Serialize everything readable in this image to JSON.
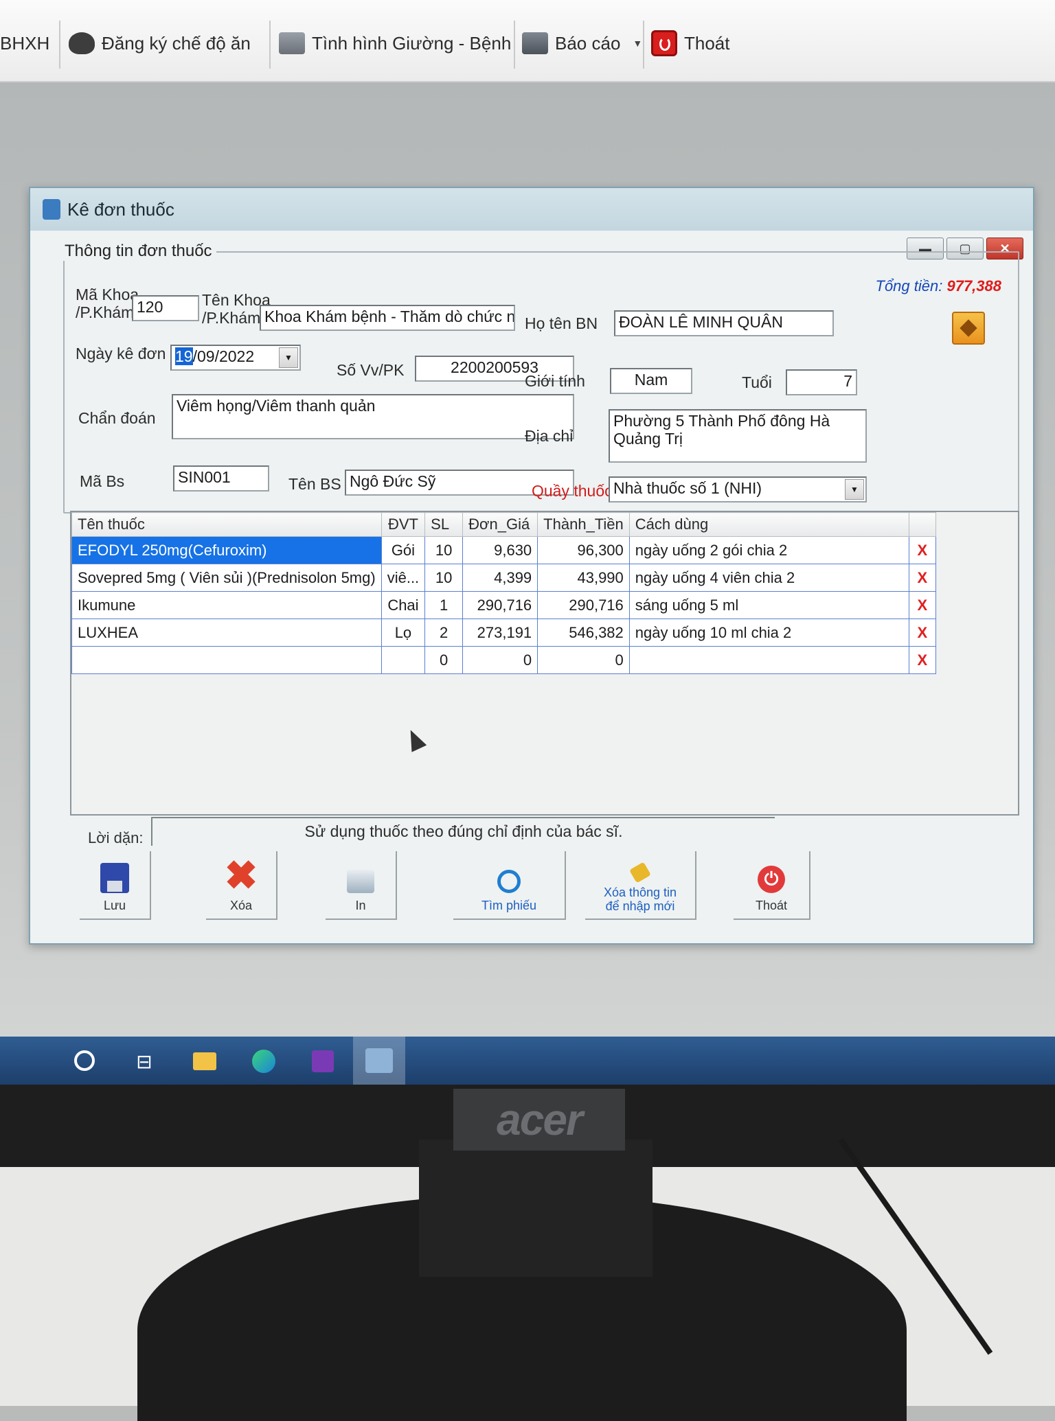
{
  "toolbar": {
    "items": [
      {
        "label": "BHXH"
      },
      {
        "label": "Đăng ký chế độ ăn",
        "icon": "chef-hat-icon"
      },
      {
        "label": "Tình hình Giường - Bệnh",
        "icon": "bed-icon"
      },
      {
        "label": "Báo cáo",
        "icon": "report-icon"
      },
      {
        "label": "Thoát",
        "icon": "exit-icon"
      }
    ]
  },
  "dialog": {
    "title": "Kê đơn thuốc",
    "group_title": "Thông tin đơn thuốc",
    "total_label": "Tổng tiền:",
    "total_value": "977,388",
    "labels": {
      "ma_khoa": "Mã Khoa /P.Khám",
      "ten_khoa": "Tên Khoa /P.Khám",
      "ho_ten": "Họ tên BN",
      "ngay_ke_don": "Ngày kê đơn",
      "so_vv": "Số Vv/PK",
      "gioi_tinh": "Giới tính",
      "tuoi": "Tuổi",
      "chan_doan": "Chẩn đoán",
      "dia_chi": "Địa chỉ",
      "ma_bs": "Mã Bs",
      "ten_bs": "Tên BS",
      "quay_thuoc": "Quầy thuốc"
    },
    "values": {
      "ma_khoa": "120",
      "ten_khoa": "Khoa Khám bệnh - Thăm dò chức n",
      "ho_ten": "ĐOÀN LÊ MINH QUÂN",
      "ngay_ke_don_day": "19",
      "ngay_ke_don_rest": "/09/2022",
      "so_vv": "2200200593",
      "gioi_tinh": "Nam",
      "tuoi": "7",
      "chan_doan": "Viêm họng/Viêm thanh quản",
      "dia_chi": "Phường 5 Thành Phố đông Hà Quảng Trị",
      "ma_bs": "SIN001",
      "ten_bs": "Ngô Đức Sỹ",
      "quay_thuoc": "Nhà thuốc số 1 (NHI)"
    }
  },
  "grid": {
    "columns": [
      "Tên thuốc",
      "ĐVT",
      "SL",
      "Đơn_Giá",
      "Thành_Tiền",
      "Cách dùng",
      ""
    ],
    "rows": [
      {
        "ten": "EFODYL 250mg(Cefuroxim)",
        "dvt": "Gói",
        "sl": "10",
        "gia": "9,630",
        "tien": "96,300",
        "cach": "ngày uống 2 gói chia 2",
        "del": "X"
      },
      {
        "ten": "Sovepred 5mg ( Viên sủi )(Prednisolon 5mg)",
        "dvt": "viê...",
        "sl": "10",
        "gia": "4,399",
        "tien": "43,990",
        "cach": "ngày uống 4 viên chia 2",
        "del": "X"
      },
      {
        "ten": "Ikumune",
        "dvt": "Chai",
        "sl": "1",
        "gia": "290,716",
        "tien": "290,716",
        "cach": "sáng uống 5 ml",
        "del": "X"
      },
      {
        "ten": "LUXHEA",
        "dvt": "Lọ",
        "sl": "2",
        "gia": "273,191",
        "tien": "546,382",
        "cach": "ngày uống 10 ml chia 2",
        "del": "X"
      },
      {
        "ten": "",
        "dvt": "",
        "sl": "0",
        "gia": "0",
        "tien": "0",
        "cach": "",
        "del": "X"
      }
    ]
  },
  "note": {
    "label": "Lời dặn:",
    "value": "Sử dụng thuốc theo đúng chỉ định của bác sĩ."
  },
  "actions": {
    "save": "Lưu",
    "delete": "Xóa",
    "print": "In",
    "find": "Tìm phiếu",
    "clear_line1": "Xóa thông tin",
    "clear_line2": "để nhập mới",
    "exit": "Thoát"
  },
  "monitor_brand": "acer"
}
